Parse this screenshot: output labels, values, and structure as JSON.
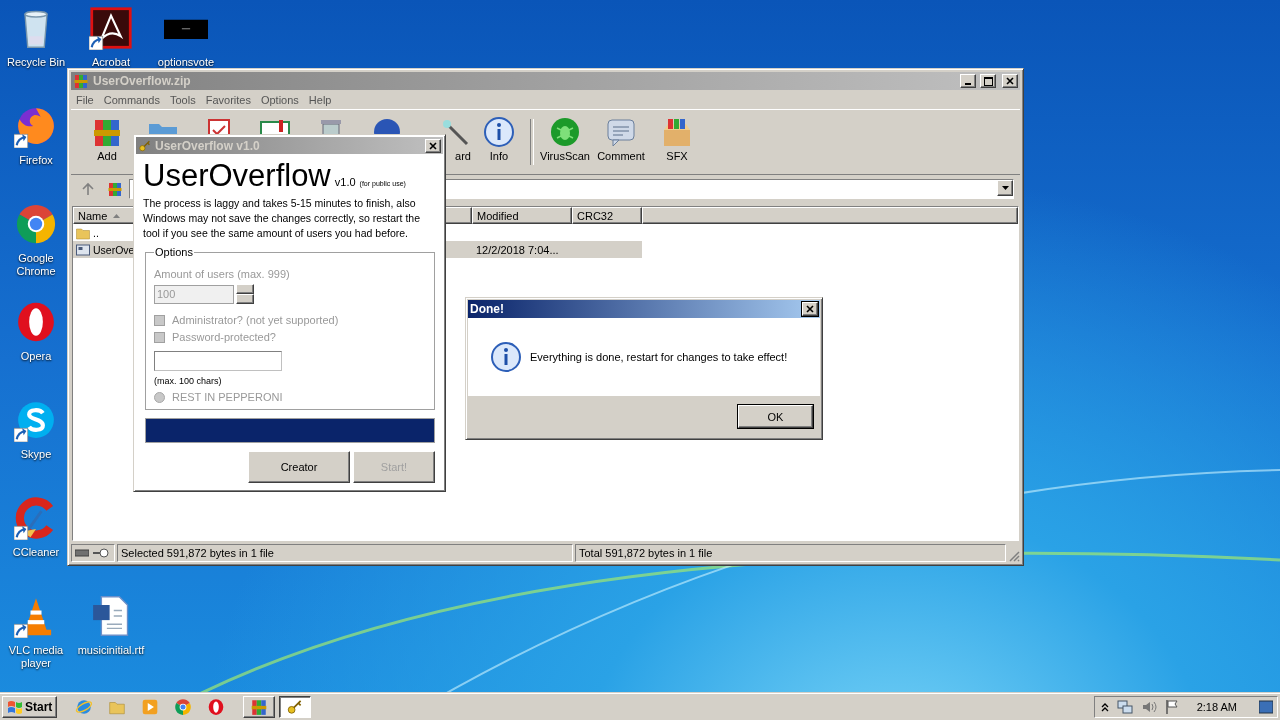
{
  "desktop_icons": [
    {
      "label": "Recycle Bin",
      "kind": "recycle"
    },
    {
      "label": "Acrobat",
      "kind": "acrobat"
    },
    {
      "label": "optionsvote",
      "kind": "dark"
    },
    {
      "label": "Firefox",
      "kind": "firefox"
    },
    {
      "label": "Google Chrome",
      "kind": "chrome"
    },
    {
      "label": "Opera",
      "kind": "opera"
    },
    {
      "label": "Skype",
      "kind": "skype"
    },
    {
      "label": "CCleaner",
      "kind": "ccleaner"
    },
    {
      "label": "VLC media player",
      "kind": "vlc"
    },
    {
      "label": "musicinitial.rtf",
      "kind": "word"
    }
  ],
  "archive_window": {
    "title": "UserOverflow.zip",
    "menu": [
      "File",
      "Commands",
      "Tools",
      "Favorites",
      "Options",
      "Help"
    ],
    "toolbar": [
      {
        "kind": "add",
        "label": "Add"
      },
      {
        "kind": "extract"
      },
      {
        "kind": "test"
      },
      {
        "kind": "view"
      },
      {
        "kind": "delete"
      },
      {
        "kind": "find"
      },
      {
        "kind": "wizard",
        "label": "ard"
      },
      {
        "kind": "info",
        "label": "Info"
      },
      {
        "kind": "virusscan",
        "label": "VirusScan"
      },
      {
        "kind": "comment",
        "label": "Comment"
      },
      {
        "kind": "sfx",
        "label": "SFX"
      }
    ],
    "columns": [
      {
        "label": "Name",
        "sorted": true
      },
      {
        "label": "Modified",
        "sorted": false
      },
      {
        "label": "CRC32",
        "sorted": false
      }
    ],
    "rows": [
      {
        "kind": "folder",
        "name": "..",
        "selected": false
      },
      {
        "kind": "file",
        "name": "UserOve",
        "modified": "12/2/2018 7:04...",
        "selected": true
      }
    ],
    "status_left": "Selected 591,872 bytes in 1 file",
    "status_right": "Total 591,872 bytes in 1 file"
  },
  "tool_dialog": {
    "title": "UserOverflow v1.0",
    "heading": "UserOverflow",
    "version": "v1.0",
    "version_note": "(for public use)",
    "description": "The process is laggy and takes 5-15 minutes to finish, also Windows may not save the changes correctly, so restart the tool if you see the same amount of users you had before.",
    "group_label": "Options",
    "amount_label": "Amount of users (max. 999)",
    "amount_field": {
      "value": "100",
      "disabled": true
    },
    "options": [
      {
        "kind": "checkbox",
        "label": "Administrator? (not yet supported)",
        "checked": false,
        "disabled": true
      },
      {
        "kind": "checkbox",
        "label": "Password-protected?",
        "checked": false,
        "disabled": true
      }
    ],
    "password_hint": "(max. 100 chars)",
    "radio": {
      "label": "REST IN PEPPERONI",
      "selected": false,
      "disabled": true
    },
    "progress": {
      "level": 1
    },
    "buttons": [
      {
        "label": "Creator",
        "disabled": false
      },
      {
        "label": "Start!",
        "disabled": true
      }
    ]
  },
  "message_box": {
    "title": "Done!",
    "message": "Everything is done, restart for changes to take effect!",
    "button": "OK"
  },
  "taskbar": {
    "start": "Start",
    "quick_launch": [
      {
        "kind": "ie"
      },
      {
        "kind": "explorer"
      },
      {
        "kind": "media"
      },
      {
        "kind": "chrome"
      },
      {
        "kind": "opera"
      }
    ],
    "tasks": [
      {
        "kind": "add",
        "active": false
      },
      {
        "kind": "key",
        "active": true
      }
    ],
    "clock": "2:18 AM"
  }
}
